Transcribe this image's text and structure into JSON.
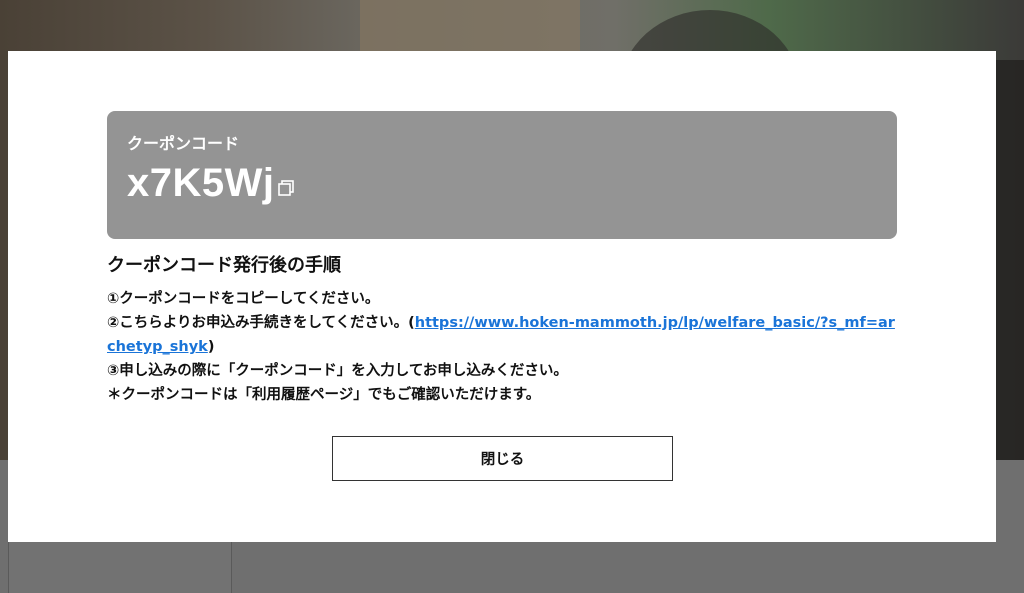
{
  "coupon": {
    "label": "クーポンコード",
    "code": "x7K5Wj",
    "copy_icon": "copy-icon"
  },
  "instructions": {
    "title": "クーポンコード発行後の手順",
    "step1": "①クーポンコードをコピーしてください。",
    "step2_prefix": "②こちらよりお申込み手続きをしてください。(",
    "step2_link": "https://www.hoken-mammoth.jp/lp/welfare_basic/?s_mf=archetyp_shyk",
    "step2_suffix": ")",
    "step3": "③申し込みの際に「クーポンコード」を入力してお申し込みください。",
    "note": "＊クーポンコードは「利用履歴ページ」でもご確認いただけます。"
  },
  "close_button": {
    "label": "閉じる"
  },
  "colors": {
    "coupon_bg": "#949494",
    "link": "#1a74d8",
    "overlay": "#6e6e6e"
  }
}
